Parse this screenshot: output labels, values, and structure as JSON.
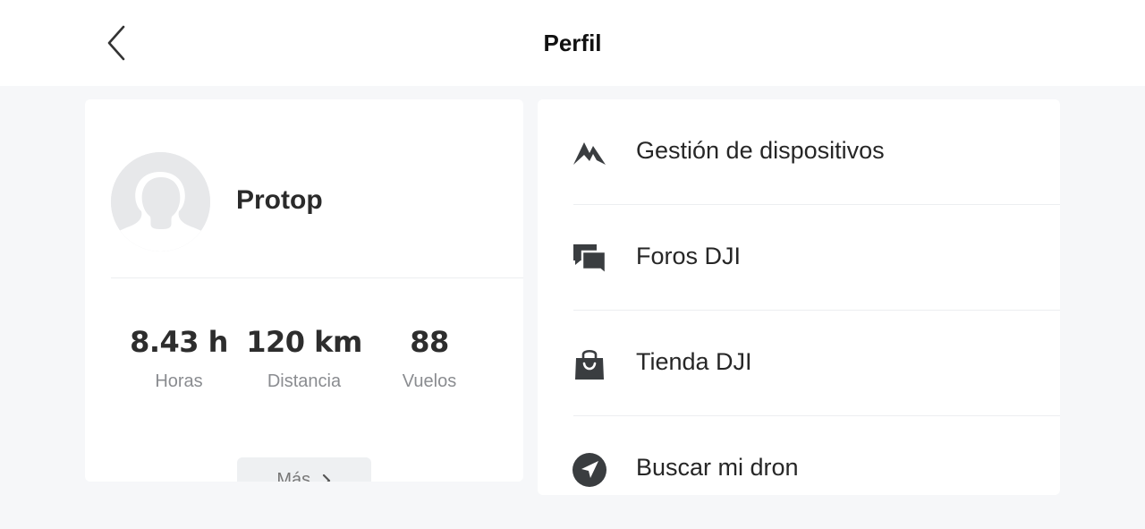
{
  "header": {
    "title": "Perfil",
    "back_icon": "chevron-left-icon"
  },
  "profile": {
    "avatar_icon": "default-avatar-icon",
    "username": "Protop",
    "stats": [
      {
        "value": "8.43 h",
        "label": "Horas"
      },
      {
        "value": "120 km",
        "label": "Distancia"
      },
      {
        "value": "88",
        "label": "Vuelos"
      }
    ],
    "more_label": "Más",
    "more_icon": "chevron-right-icon"
  },
  "menu": {
    "items": [
      {
        "label": "Gestión de dispositivos",
        "icon": "dji-logo-icon"
      },
      {
        "label": "Foros DJI",
        "icon": "chat-bubbles-icon"
      },
      {
        "label": "Tienda DJI",
        "icon": "shopping-bag-icon"
      },
      {
        "label": "Buscar mi dron",
        "icon": "navigation-arrow-icon"
      }
    ]
  },
  "colors": {
    "background": "#f6f7f9",
    "card": "#ffffff",
    "primary_text": "#222222",
    "secondary_text": "#8a8c90",
    "icon": "#3a3d40"
  }
}
